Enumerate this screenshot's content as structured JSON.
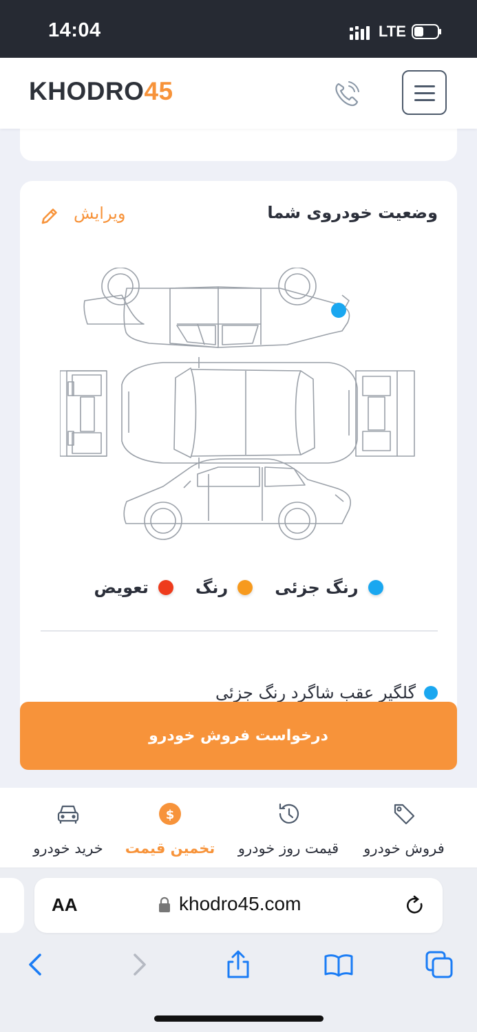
{
  "status_bar": {
    "time": "14:04",
    "network": "LTE"
  },
  "header": {
    "logo_main": "KHODRO",
    "logo_number": "45"
  },
  "car_status": {
    "title": "وضعیت خودروی شما",
    "edit_label": "ویرایش",
    "legend": [
      {
        "label": "رنگ جزئی",
        "color": "#1aa7f0"
      },
      {
        "label": "رنگ",
        "color": "#f79a1e"
      },
      {
        "label": "تعویض",
        "color": "#ee3b1c"
      }
    ],
    "damage_items": [
      {
        "label": "گلگیر عقب شاگرد رنگ جزئی",
        "color": "#1aa7f0"
      }
    ]
  },
  "cta": {
    "label": "درخواست فروش خودرو"
  },
  "bottom_nav": [
    {
      "label": "فروش خودرو",
      "icon": "tag-icon",
      "active": false
    },
    {
      "label": "قیمت روز خودرو",
      "icon": "history-clock-icon",
      "active": false
    },
    {
      "label": "تخمین قیمت",
      "icon": "dollar-circle-icon",
      "active": true
    },
    {
      "label": "خرید خودرو",
      "icon": "car-icon",
      "active": false
    }
  ],
  "browser": {
    "text_size_label": "AA",
    "url": "khodro45.com"
  },
  "colors": {
    "accent": "#f7933a",
    "dark": "#262a33"
  }
}
